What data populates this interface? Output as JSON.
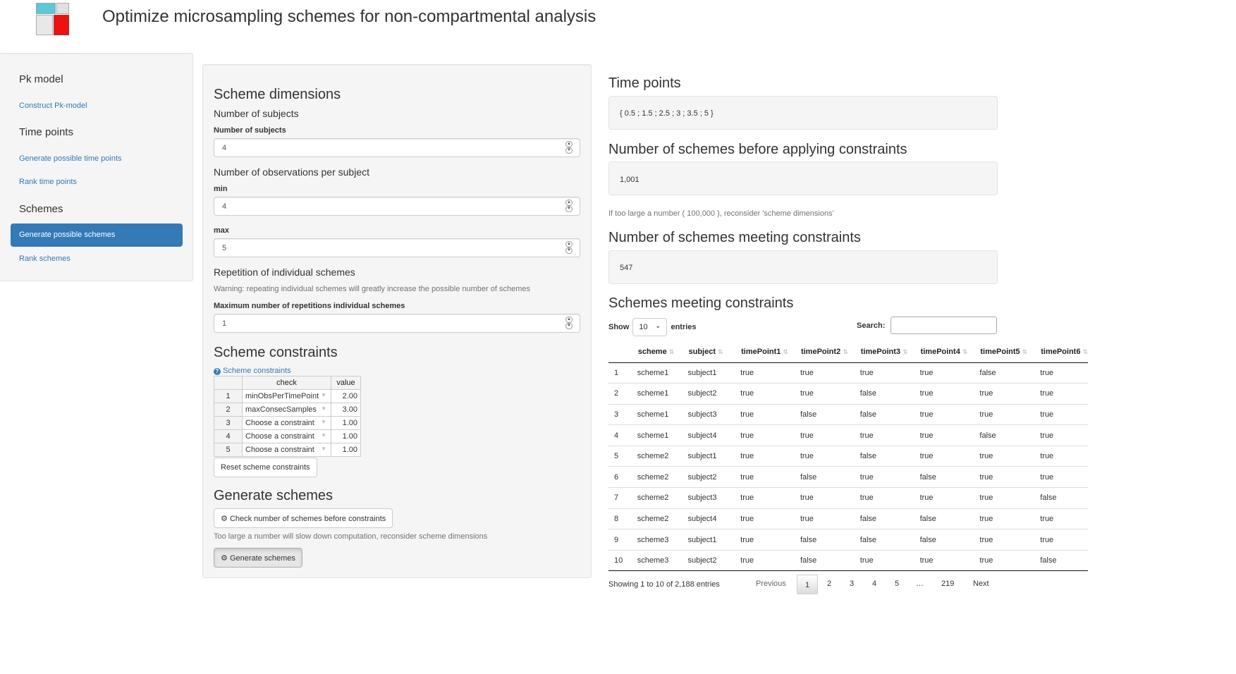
{
  "app": {
    "title": "Optimize microsampling schemes for non-compartmental analysis",
    "logo_colors": [
      "#5bc8d8",
      "#e0e0e0",
      "#e8e8e8",
      "#ee1111"
    ]
  },
  "sidebar": {
    "sections": [
      {
        "title": "Pk model",
        "items": [
          {
            "label": "Construct Pk-model"
          }
        ]
      },
      {
        "title": "Time points",
        "items": [
          {
            "label": "Generate possible time points"
          },
          {
            "label": "Rank time points"
          }
        ]
      },
      {
        "title": "Schemes",
        "items": [
          {
            "label": "Generate possible schemes",
            "active": true
          },
          {
            "label": "Rank schemes"
          }
        ]
      }
    ]
  },
  "dimensions": {
    "heading": "Scheme dimensions",
    "subjects_heading": "Number of subjects",
    "subjects_label": "Number of subjects",
    "subjects_value": "4",
    "obs_heading": "Number of observations per subject",
    "min_label": "min",
    "min_value": "4",
    "max_label": "max",
    "max_value": "5",
    "rep_heading": "Repetition of individual schemes",
    "rep_warning": "Warning: repeating individual schemes will greatly increase the possible number of schemes",
    "rep_label": "Maximum number of repetitions individual schemes",
    "rep_value": "1"
  },
  "constraints": {
    "heading": "Scheme constraints",
    "help_link": "Scheme constraints",
    "columns": [
      "check",
      "value"
    ],
    "rows": [
      {
        "n": "1",
        "check": "minObsPerTimePoint",
        "value": "2.00"
      },
      {
        "n": "2",
        "check": "maxConsecSamples",
        "value": "3.00"
      },
      {
        "n": "3",
        "check": "Choose a constraint",
        "value": "1.00"
      },
      {
        "n": "4",
        "check": "Choose a constraint",
        "value": "1.00"
      },
      {
        "n": "5",
        "check": "Choose a constraint",
        "value": "1.00"
      }
    ],
    "reset_button": "Reset scheme constraints"
  },
  "generate": {
    "heading": "Generate schemes",
    "check_button": "Check number of schemes before constraints",
    "help": "Too large a number will slow down computation, reconsider scheme dimensions",
    "generate_button": "Generate schemes"
  },
  "results": {
    "timepoints_heading": "Time points",
    "timepoints_value": "{ 0.5 ; 1.5 ; 2.5 ; 3 ; 3.5 ; 5 }",
    "before_heading": "Number of schemes before applying constraints",
    "before_value": "1,001",
    "before_help": "If too large a number ( 100,000 ), reconsider 'scheme dimensions'",
    "meeting_heading": "Number of schemes meeting constraints",
    "meeting_value": "547",
    "table_heading": "Schemes meeting constraints"
  },
  "table": {
    "show_label": "Show",
    "entries_value": "10",
    "entries_label": "entries",
    "search_label": "Search:",
    "search_value": "",
    "columns": [
      "scheme",
      "subject",
      "timePoint1",
      "timePoint2",
      "timePoint3",
      "timePoint4",
      "timePoint5",
      "timePoint6"
    ],
    "rows": [
      [
        "1",
        "scheme1",
        "subject1",
        "true",
        "true",
        "true",
        "true",
        "false",
        "true"
      ],
      [
        "2",
        "scheme1",
        "subject2",
        "true",
        "true",
        "false",
        "true",
        "true",
        "true"
      ],
      [
        "3",
        "scheme1",
        "subject3",
        "true",
        "false",
        "false",
        "true",
        "true",
        "true"
      ],
      [
        "4",
        "scheme1",
        "subject4",
        "true",
        "true",
        "true",
        "true",
        "false",
        "true"
      ],
      [
        "5",
        "scheme2",
        "subject1",
        "true",
        "true",
        "false",
        "true",
        "true",
        "true"
      ],
      [
        "6",
        "scheme2",
        "subject2",
        "true",
        "false",
        "true",
        "false",
        "true",
        "true"
      ],
      [
        "7",
        "scheme2",
        "subject3",
        "true",
        "true",
        "true",
        "true",
        "true",
        "false"
      ],
      [
        "8",
        "scheme2",
        "subject4",
        "true",
        "true",
        "false",
        "false",
        "true",
        "true"
      ],
      [
        "9",
        "scheme3",
        "subject1",
        "true",
        "false",
        "false",
        "false",
        "true",
        "true"
      ],
      [
        "10",
        "scheme3",
        "subject2",
        "true",
        "false",
        "true",
        "true",
        "true",
        "false"
      ]
    ],
    "info": "Showing 1 to 10 of 2,188 entries",
    "pagination": {
      "previous": "Previous",
      "current": "1",
      "pages": [
        "2",
        "3",
        "4",
        "5",
        "…",
        "219"
      ],
      "next": "Next"
    }
  }
}
